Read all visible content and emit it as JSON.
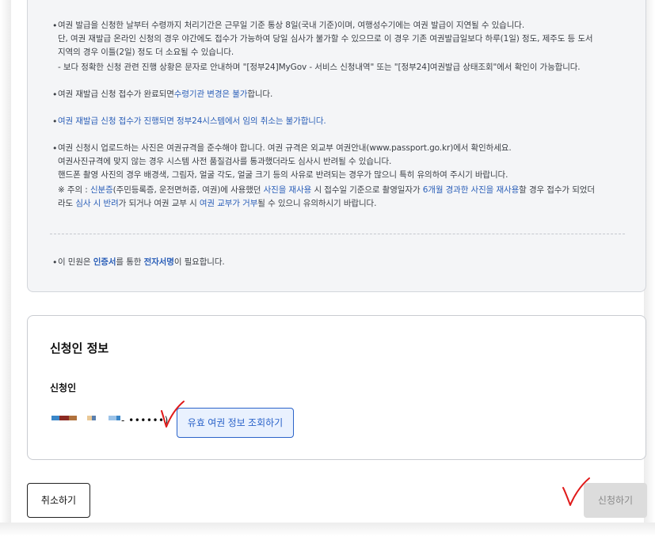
{
  "notice": {
    "item1": {
      "l1": "여권 발급을 신청한 날부터 수령까지 처리기간은 근무일 기준 통상 8일(국내 기준)이며, 여행성수기에는 여권 발급이 지연될 수 있습니다.",
      "l2": "단, 여권 재발급 온라인 신청의 경우 야간에도 접수가 가능하여 당일 심사가 불가할 수 있으므로 이 경우 기존 여권발급일보다 하루(1일) 정도, 제주도 등 도서",
      "l3": "지역의 경우 이틀(2일) 정도 더 소요될 수 있습니다.",
      "l4": "- 보다 정확한 신청 관련 진행 상황은 문자로 안내하며 \"[정부24]MyGov - 서비스 신청내역\" 또는 \"[정부24]여권발급 상태조회\"에서 확인이 가능합니다."
    },
    "item2": {
      "a": "여권 재발급 신청 접수가 완료되면",
      "b": "수령기관 변경은 불가",
      "c": "합니다."
    },
    "item3": "여권 재발급 신청 접수가 진행되면 정부24시스템에서 임의 취소는 불가합니다.",
    "item4": {
      "l1": "여권 신청시 업로드하는 사진은 여권규격을 준수해야 합니다. 여권 규격은 외교부 여권안내(www.passport.go.kr)에서 확인하세요.",
      "l2": "여권사진규격에 맞지 않는 경우 시스템 사전 품질검사를 통과했더라도 심사시 반려될 수 있습니다.",
      "l3": "핸드폰 촬영 사진의 경우 배경색, 그림자, 얼굴 각도, 얼굴 크기 등의 사유로 반려되는 경우가 많으니 특히 유의하여 주시기 바랍니다.",
      "l4a": "※ 주의 : ",
      "l4b": "신분증",
      "l4c": "(주민등록증, 운전면허증, 여권)에 사용했던 ",
      "l4d": "사진을 재사용",
      "l4e": " 시 접수일 기준으로 촬영일자가 ",
      "l4f": "6개월 경과한 사진을 재사용",
      "l4g": "할 경우 접수가 되었더",
      "l5a": "라도 ",
      "l5b": "심사 시 반려",
      "l5c": "가 되거나 여권 교부 시 ",
      "l5d": "여권 교부가 거부",
      "l5e": "될 수 있으니 유의하시기 바랍니다."
    },
    "item5": {
      "a": "이 민원은 ",
      "b": "인증서",
      "c": "를 통한 ",
      "d": "전자서명",
      "e": "이 필요합니다."
    },
    "bullet": "•"
  },
  "applicant_info": {
    "title": "신청인 정보",
    "applicant_label": "신청인",
    "masked_suffix": "- ••••••)",
    "check_passport_button": "유효 여권 정보 조회하기"
  },
  "footer": {
    "cancel_button": "취소하기",
    "submit_button": "신청하기"
  },
  "colors": {
    "accent": "#2b63c9",
    "annotation": "#e01a1a"
  }
}
